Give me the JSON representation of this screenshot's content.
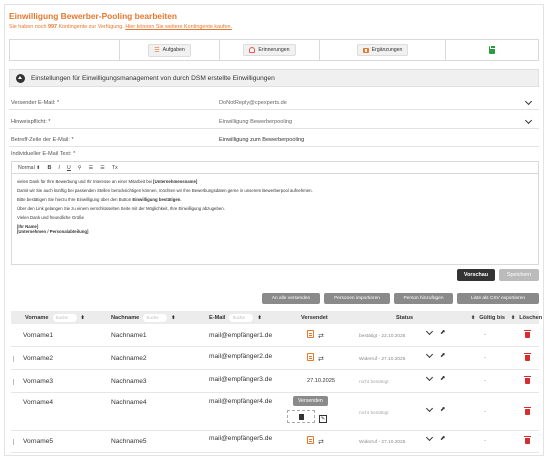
{
  "header": {
    "title": "Einwilligung Bewerber-Pooling bearbeiten",
    "quota_prefix": "Sie haben noch ",
    "quota_count": "997",
    "quota_suffix": " Kontingente zur Verfügung. ",
    "quota_link": "Hier können Sie weitere Kontingente kaufen."
  },
  "tabs": {
    "aufgaben": "Aufgaben",
    "erinnerungen": "Erinnerungen",
    "ergaenzungen": "Ergänzungen"
  },
  "settings": {
    "label": "Einstellungen für Einwilligungsmanagement von durch DSM erstellte Einwilligungen"
  },
  "form": {
    "sender_label": "Versender E-Mail: *",
    "sender_value": "DoNotReply@cpexperts.de",
    "notice_label": "Hinweispflicht: *",
    "notice_value": "Einwilligung Bewerberpooling",
    "subject_label": "Betreff-Zeile der E-Mail: *",
    "subject_value": "Einwilligung zum Bewerberpooling",
    "text_label": "Individueller E-Mail Text: *"
  },
  "editor": {
    "toolbar": {
      "format": "Normal",
      "bold": "B",
      "italic": "I",
      "underline": "U",
      "link": "🔗",
      "ol": "☰",
      "ul": "☰",
      "clear": "Tx"
    },
    "p1a": "vielen Dank für Ihre Bewerbung und Ihr Interesse an einer Mitarbeit bei ",
    "p1b": "[Unternehmensname]",
    "p2": "Damit wir Sie auch künftig bei passenden Stellen berücksichtigen können, möchten wir Ihre Bewerbungsdaten gerne in unserem Bewerberpool aufnehmen.",
    "p3a": "Bitte bestätigen Sie hierzu Ihre Einwilligung über den Button ",
    "p3b": "Einwilligung bestätigen",
    "p3c": ".",
    "p4": "Über den Link gelangen Sie zu einem verschlüsselten Seite mit der Möglichkeit, Ihre Einwilligung abzugeben.",
    "p5": "Vielen Dank und freundliche Grüße",
    "sig1": "[Ihr Name]",
    "sig2": "[Unternehmen / Personalabteilung]"
  },
  "buttons": {
    "preview": "Vorschau",
    "save": "Speichern",
    "send_all": "An alle versenden",
    "import": "Personen importieren",
    "add": "Person hinzufügen",
    "export": "Liste als CSV exportieren"
  },
  "table": {
    "headers": {
      "vorname": "Vorname",
      "nachname": "Nachname",
      "email": "E-Mail",
      "versendet": "Versendet",
      "status": "Status",
      "gueltig": "Gültig bis",
      "loeschen": "Löschen",
      "search": "Suche"
    },
    "rows": [
      {
        "vorname": "Vorname1",
        "nachname": "Nachname1",
        "email": "mail@empfänger1.de",
        "versendet": "",
        "status": "bestätigt - 22.10.2025",
        "gueltig": "-"
      },
      {
        "vorname": "Vorname2",
        "nachname": "Nachname2",
        "email": "mail@empfänger2.de",
        "versendet": "",
        "status": "Widerruf - 27.10.2025",
        "gueltig": "-"
      },
      {
        "vorname": "Vorname3",
        "nachname": "Nachname3",
        "email": "mail@empfänger3.de",
        "versendet": "27.10.2025",
        "status": "nicht bestätigt",
        "gueltig": "-"
      },
      {
        "vorname": "Vorname4",
        "nachname": "Nachname4",
        "email": "mail@empfänger4.de",
        "versendet": "Versenden",
        "status": "nicht bestätigt",
        "gueltig": "-"
      },
      {
        "vorname": "Vorname5",
        "nachname": "Nachname5",
        "email": "mail@empfänger5.de",
        "versendet": "",
        "status": "Widerruf - 27.10.2025",
        "gueltig": "-"
      }
    ]
  },
  "colors": {
    "accent": "#e8762b",
    "danger": "#d32f2f",
    "success": "#2a9d3d"
  }
}
